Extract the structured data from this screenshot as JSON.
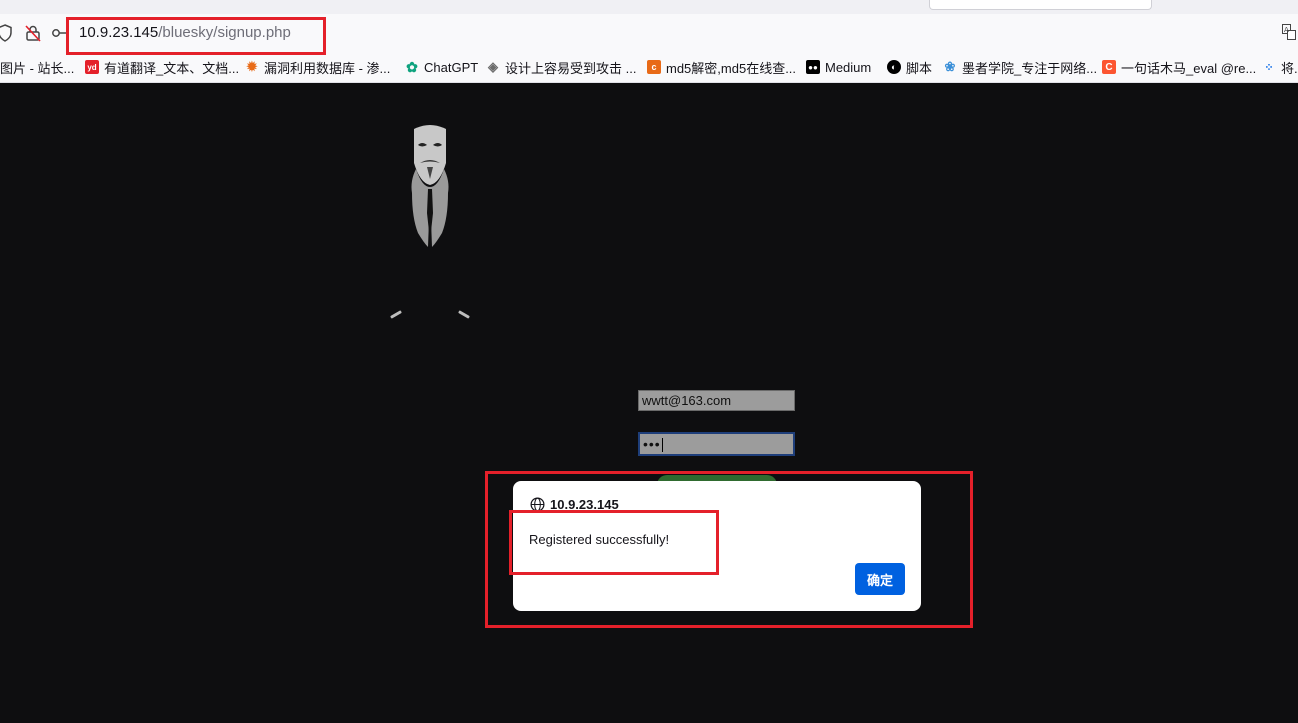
{
  "browser": {
    "url_host": "10.9.23.145",
    "url_path": "/bluesky/signup.php",
    "bookmarks": [
      {
        "label": "图片 - 站长...",
        "icon": "generic-icon",
        "color": "#7a7a7a"
      },
      {
        "label": "有道翻译_文本、文档...",
        "icon": "youdao-icon",
        "color": "#e4202a"
      },
      {
        "label": "漏洞利用数据库 - 渗...",
        "icon": "exploitdb-icon",
        "color": "#e86a17"
      },
      {
        "label": "ChatGPT",
        "icon": "chatgpt-icon",
        "color": "#10a37f"
      },
      {
        "label": "设计上容易受到攻击 ...",
        "icon": "diamond-icon",
        "color": "#6b6b6b"
      },
      {
        "label": "md5解密,md5在线查...",
        "icon": "md5-icon",
        "color": "#e86a17"
      },
      {
        "label": "Medium",
        "icon": "medium-icon",
        "color": "#000000"
      },
      {
        "label": "脚本",
        "icon": "github-icon",
        "color": "#000000"
      },
      {
        "label": "墨者学院_专注于网络...",
        "icon": "mozhe-icon",
        "color": "#3a8fd8"
      },
      {
        "label": "一句话木马_eval @re...",
        "icon": "csdn-icon",
        "color": "#fc5531"
      },
      {
        "label": "将...",
        "icon": "grid-icon",
        "color": "#1a73e8"
      }
    ]
  },
  "form": {
    "email_value": "wwtt@163.com",
    "password_mask": "•••"
  },
  "dialog": {
    "origin": "10.9.23.145",
    "message": "Registered successfully!",
    "ok_label": "确定"
  },
  "colors": {
    "annotation_red": "#e4202a",
    "page_bg": "#0e0e10",
    "ok_button": "#0061e0"
  }
}
